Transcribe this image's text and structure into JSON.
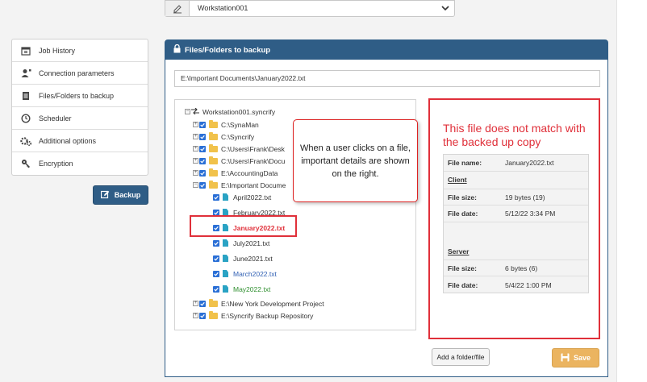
{
  "top_selector": {
    "value": "Workstation001"
  },
  "nav": {
    "items": [
      {
        "label": "Job History",
        "icon": "calendar-icon"
      },
      {
        "label": "Connection parameters",
        "icon": "user-network-icon"
      },
      {
        "label": "Files/Folders to backup",
        "icon": "document-icon"
      },
      {
        "label": "Scheduler",
        "icon": "clock-icon"
      },
      {
        "label": "Additional options",
        "icon": "gears-icon"
      },
      {
        "label": "Encryption",
        "icon": "key-icon"
      }
    ],
    "backup_label": "Backup"
  },
  "panel": {
    "title": "Files/Folders to backup",
    "path_value": "E:\\Important Documents\\January2022.txt"
  },
  "tree": {
    "root": "Workstation001.syncrify",
    "folders": [
      "C:\\SynaMan",
      "C:\\Syncrify",
      "C:\\Users\\Frank\\Desk",
      "C:\\Users\\Frank\\Docu",
      "E:\\AccountingData",
      "E:\\Important Docume"
    ],
    "files": [
      "April2022.txt",
      "February2022.txt",
      "January2022.txt",
      "July2021.txt",
      "June2021.txt",
      "March2022.txt",
      "May2022.txt"
    ],
    "after_folders": [
      "E:\\New York Development Project",
      "E:\\Syncrify Backup Repository"
    ]
  },
  "callout": "When a user clicks on a file, important details are shown on the right.",
  "mismatch_message": "This file does not match with the backed up copy",
  "details": {
    "file_name_label": "File name:",
    "file_name": "January2022.txt",
    "client_heading": "Client",
    "client_size_label": "File size:",
    "client_size": "19 bytes (19)",
    "client_date_label": "File date:",
    "client_date": "5/12/22 3:34 PM",
    "server_heading": "Server",
    "server_size_label": "File size:",
    "server_size": "6 bytes (6)",
    "server_date_label": "File date:",
    "server_date": "5/4/22 1:00 PM"
  },
  "buttons": {
    "add": "Add a folder/file",
    "save": "Save"
  },
  "colors": {
    "accent": "#2f5d86",
    "highlight": "#e0303a",
    "save": "#ebb460"
  }
}
